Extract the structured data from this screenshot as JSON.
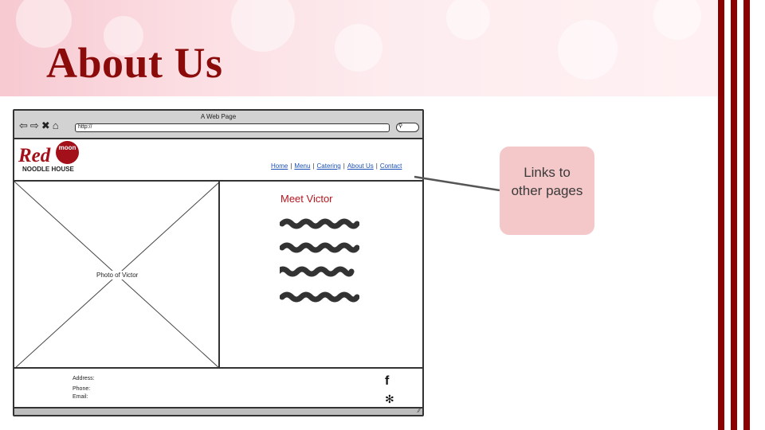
{
  "slide": {
    "title": "About Us",
    "colors": {
      "title": "#8b0a0a",
      "stripes": "#8b0000",
      "callout_bg": "#f4c7c8"
    }
  },
  "wireframe": {
    "window_title": "A Web Page",
    "url": "http://",
    "nav_icons": [
      "back-arrow-icon",
      "forward-arrow-icon",
      "close-x-icon",
      "home-icon"
    ],
    "logo": {
      "word": "Red",
      "badge": "moon",
      "subtitle": "NOODLE HOUSE"
    },
    "nav_links": [
      "Home",
      "Menu",
      "Catering",
      "About Us",
      "Contact"
    ],
    "photo_label": "Photo of Victor",
    "section_heading": "Meet Victor",
    "contact": {
      "address_label": "Address:",
      "phone_label": "Phone:",
      "email_label": "Email:"
    },
    "social_icons": [
      "facebook-icon",
      "yelp-icon"
    ]
  },
  "callout": {
    "text": "Links to other pages"
  }
}
